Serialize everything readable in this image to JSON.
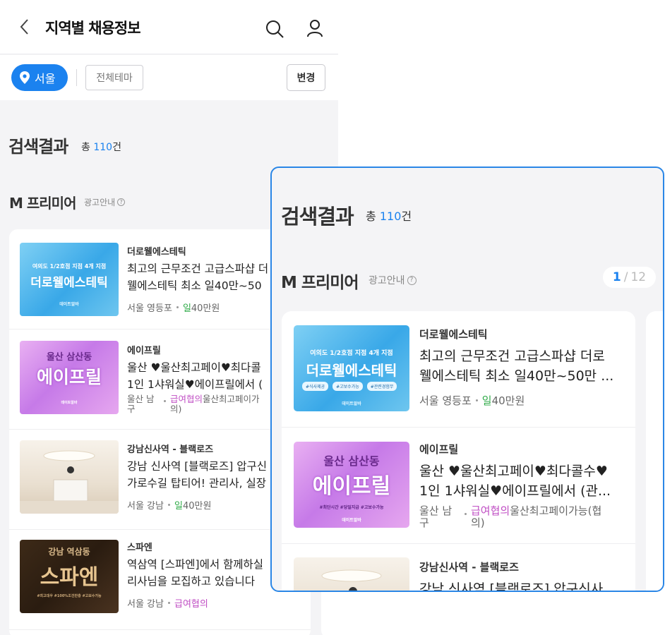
{
  "header": {
    "title": "지역별 채용정보"
  },
  "filters": {
    "location": "서울",
    "theme": "전체테마",
    "change": "변경"
  },
  "results": {
    "title": "검색결과",
    "total_prefix": "총",
    "total_count": "110",
    "total_suffix": "건"
  },
  "premium": {
    "title": "M 프리미어",
    "ad_info": "광고안내",
    "page_current": "1",
    "page_sep": "/",
    "page_total": "12"
  },
  "items": [
    {
      "name": "더로웰에스테틱",
      "desc_line1": "최고의 근무조건 고급스파샵 더로",
      "desc_line2": "웰에스테틱 최소 일40만~50만 ...",
      "region": "서울 영등포",
      "pay_type": "일",
      "pay_value": "40만원",
      "thumb_top": "여의도 1/2호점 지점 4개 지점",
      "thumb_main": "더로웰에스테틱",
      "thumb_tags": [
        "#식사제공",
        "#고보수가능",
        "#관련경험무"
      ],
      "thumb_mark": "데이트알바",
      "short_desc_line1": "최고의 근무조건 고급스파샵 더",
      "short_desc_line2": "웰에스테틱 최소 일40만~50"
    },
    {
      "name": "에이프릴",
      "desc_line1": "울산 ♥울산최고페이♥최다콜수♥",
      "desc_line2": "1인 1샤워실♥에이프릴에서 (관...",
      "region_line1": "울산 남",
      "region_line2": "구",
      "pay_type": "급여협의",
      "pay_note_line1": "울산최고페이가능(협",
      "pay_note_line2": "의)",
      "thumb_top": "울산 삼산동",
      "thumb_main": "에이프릴",
      "thumb_tags": "#최단시간 #당일지급 #고보수가능",
      "thumb_mark": "데이트알바",
      "short_desc_line1": "울산 ♥울산최고페이♥최다콜",
      "short_desc_line2": "1인 1샤워실♥에이프릴에서 (",
      "short_pay_note_line1": "울산최고페이가",
      "short_pay_note_line2": "의)"
    },
    {
      "name": "강남신사역 - 블랙로즈",
      "desc_line1": "강남 신사역 [블랙로즈] 압구신사",
      "short_desc_line1": "강남 신사역 [블랙로즈] 압구신",
      "short_desc_line2": "가로수길 탑티어! 관리사, 실장",
      "region": "서울 강남",
      "pay_type": "일",
      "pay_value": "40만원"
    },
    {
      "name": "스파엔",
      "desc_line1": "역삼역 [스파엔]에서 함께하실",
      "desc_line2": "리사님을 모집하고 있습니다",
      "region": "서울 강남",
      "pay_type": "급여협의",
      "thumb_top": "강남 역삼동",
      "thumb_main": "스파엔",
      "thumb_bottom": "#최고대우 #100%조건만충 #고보수가능"
    }
  ],
  "colors": {
    "accent": "#1b82ef",
    "day_pay": "#2eaa47",
    "negotiable": "#c04fc4",
    "zoom_border": "#2a86e6"
  },
  "icons": [
    "back-arrow-icon",
    "search-icon",
    "user-icon",
    "location-pin-icon",
    "question-icon"
  ]
}
